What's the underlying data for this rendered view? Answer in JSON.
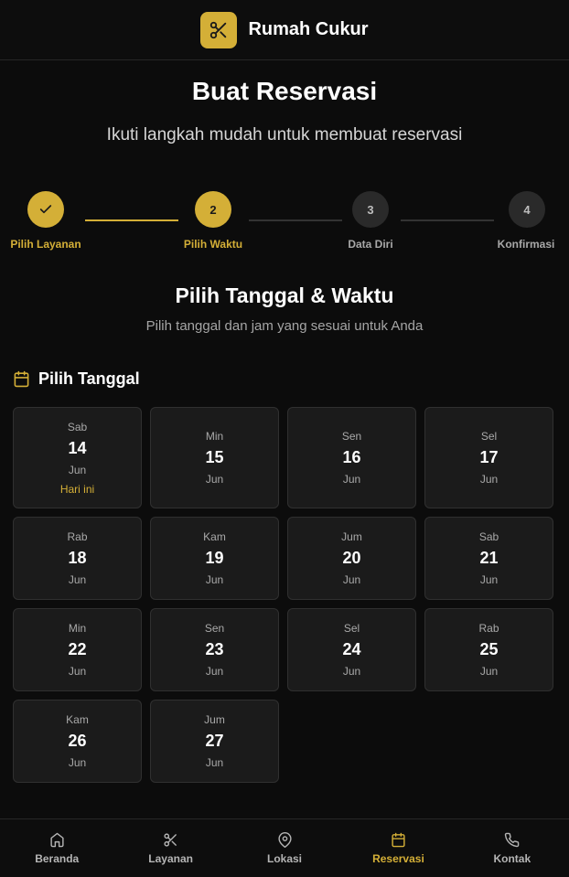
{
  "header": {
    "brand": "Rumah Cukur",
    "logo_icon": "scissors-icon"
  },
  "page": {
    "title": "Buat Reservasi",
    "subtitle": "Ikuti langkah mudah untuk membuat reservasi"
  },
  "steps": [
    {
      "label": "Pilih Layanan",
      "number": "1",
      "state": "done"
    },
    {
      "label": "Pilih Waktu",
      "number": "2",
      "state": "active"
    },
    {
      "label": "Data Diri",
      "number": "3",
      "state": "todo"
    },
    {
      "label": "Konfirmasi",
      "number": "4",
      "state": "todo"
    }
  ],
  "section": {
    "title": "Pilih Tanggal & Waktu",
    "subtitle": "Pilih tanggal dan jam yang sesuai untuk Anda"
  },
  "date_picker": {
    "heading": "Pilih Tanggal",
    "dates": [
      {
        "dow": "Sab",
        "day": "14",
        "month": "Jun",
        "tag": "Hari ini"
      },
      {
        "dow": "Min",
        "day": "15",
        "month": "Jun"
      },
      {
        "dow": "Sen",
        "day": "16",
        "month": "Jun"
      },
      {
        "dow": "Sel",
        "day": "17",
        "month": "Jun"
      },
      {
        "dow": "Rab",
        "day": "18",
        "month": "Jun"
      },
      {
        "dow": "Kam",
        "day": "19",
        "month": "Jun"
      },
      {
        "dow": "Jum",
        "day": "20",
        "month": "Jun"
      },
      {
        "dow": "Sab",
        "day": "21",
        "month": "Jun"
      },
      {
        "dow": "Min",
        "day": "22",
        "month": "Jun"
      },
      {
        "dow": "Sen",
        "day": "23",
        "month": "Jun"
      },
      {
        "dow": "Sel",
        "day": "24",
        "month": "Jun"
      },
      {
        "dow": "Rab",
        "day": "25",
        "month": "Jun"
      },
      {
        "dow": "Kam",
        "day": "26",
        "month": "Jun"
      },
      {
        "dow": "Jum",
        "day": "27",
        "month": "Jun"
      }
    ]
  },
  "nav": [
    {
      "label": "Beranda",
      "icon": "home-icon",
      "active": false
    },
    {
      "label": "Layanan",
      "icon": "scissors-icon",
      "active": false
    },
    {
      "label": "Lokasi",
      "icon": "map-pin-icon",
      "active": false
    },
    {
      "label": "Reservasi",
      "icon": "calendar-icon",
      "active": true
    },
    {
      "label": "Kontak",
      "icon": "phone-icon",
      "active": false
    }
  ],
  "colors": {
    "accent": "#d4af37",
    "background": "#0c0c0c",
    "card": "#1b1b1b"
  }
}
